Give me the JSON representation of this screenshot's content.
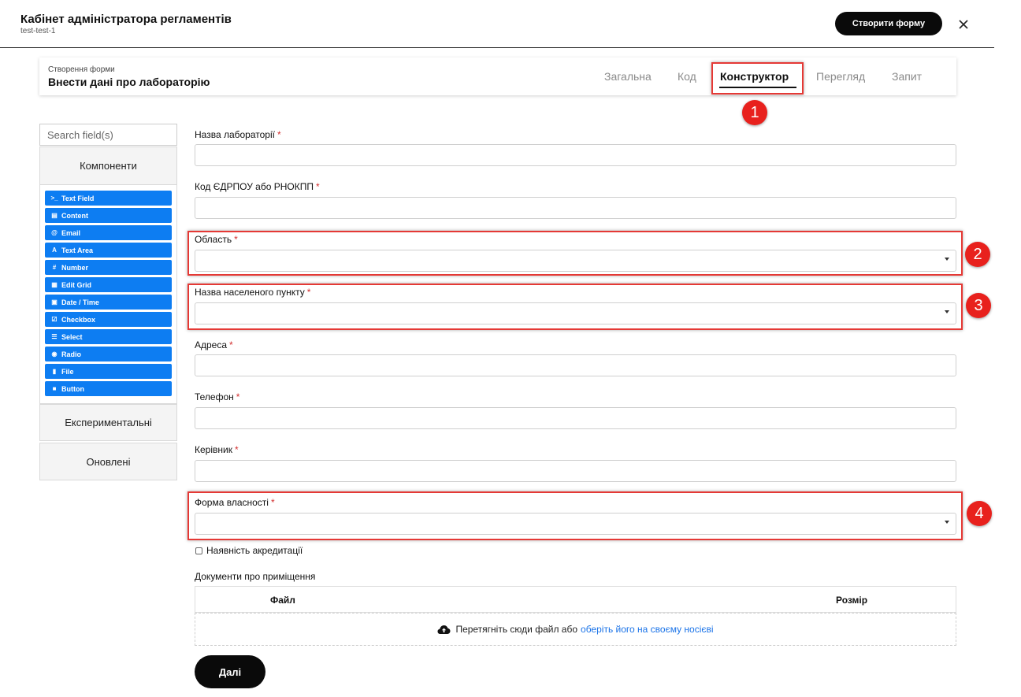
{
  "header": {
    "title": "Кабінет адміністратора регламентів",
    "subtitle": "test-test-1",
    "create_button": "Створити форму",
    "close_icon": "close-icon"
  },
  "form_card": {
    "breadcrumb": "Створення форми",
    "form_name": "Внести дані про лабораторію",
    "tabs": [
      "Загальна",
      "Код",
      "Конструктор",
      "Перегляд",
      "Запит"
    ],
    "active_tab": "Конструктор"
  },
  "sidebar": {
    "search_placeholder": "Search field(s)",
    "groups": {
      "components": "Компоненти",
      "experimental": "Експериментальні",
      "updated": "Оновлені"
    },
    "components": [
      {
        "label": "Text Field",
        "icon": "terminal-icon"
      },
      {
        "label": "Content",
        "icon": "content-icon"
      },
      {
        "label": "Email",
        "icon": "at-icon"
      },
      {
        "label": "Text Area",
        "icon": "font-icon"
      },
      {
        "label": "Number",
        "icon": "hash-icon"
      },
      {
        "label": "Edit Grid",
        "icon": "grid-icon"
      },
      {
        "label": "Date / Time",
        "icon": "calendar-icon"
      },
      {
        "label": "Checkbox",
        "icon": "checkbox-icon"
      },
      {
        "label": "Select",
        "icon": "list-icon"
      },
      {
        "label": "Radio",
        "icon": "radio-icon"
      },
      {
        "label": "File",
        "icon": "file-icon"
      },
      {
        "label": "Button",
        "icon": "button-icon"
      }
    ]
  },
  "form": {
    "required_mark": "*",
    "fields": {
      "lab_name": "Назва лабораторії",
      "edrpou": "Код ЄДРПОУ або РНОКПП",
      "region": "Область",
      "settlement": "Назва населеного пункту",
      "address": "Адреса",
      "phone": "Телефон",
      "head": "Керівник",
      "ownership": "Форма власності"
    },
    "accreditation_checkbox": "Наявність акредитації",
    "documents_label": "Документи про приміщення",
    "file_table": {
      "col_file": "Файл",
      "col_size": "Розмір"
    },
    "dropzone": {
      "text": "Перетягніть сюди файл або",
      "link": "оберіть його на своєму носієві"
    },
    "next_button": "Далі"
  },
  "annotations": [
    "1",
    "2",
    "3",
    "4"
  ],
  "colors": {
    "accent": "#0d7df2",
    "highlight": "#e53935",
    "badge": "#e8211d",
    "button": "#0a0a0a"
  }
}
